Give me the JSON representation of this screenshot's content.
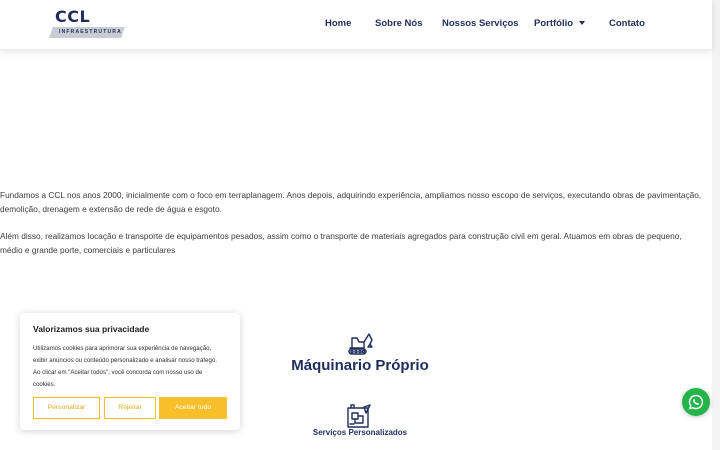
{
  "header": {
    "logo": {
      "name": "CCL",
      "subtitle": "INFRAESTRUTURA"
    },
    "nav": [
      {
        "label": "Home"
      },
      {
        "label": "Sobre Nós"
      },
      {
        "label": "Nossos Serviços"
      },
      {
        "label": "Portfólio",
        "has_dropdown": true
      },
      {
        "label": "Contato"
      }
    ]
  },
  "content": {
    "paragraph1": "Fundamos a CCL nos anos 2000, inicialmente com o foco em terraplanagem. Anos depois, adquirindo experiência, ampliamos nosso escopo de serviços, executando obras de pavimentação, demolição, drenagem e extensão de rede de água e esgoto.",
    "paragraph2": "Além disso, realizamos locação e transporte de equipamentos pesados, assim como o transporte de materiais agregados para construção civil em geral. Atuamos em obras de pequeno, médio e grande porte, comerciais e particulares"
  },
  "features": [
    {
      "icon": "excavator-icon",
      "title": "Máquinario Próprio"
    },
    {
      "icon": "blueprint-icon",
      "title": "Serviços Personalizados"
    }
  ],
  "cookie_banner": {
    "title": "Valorizamos sua privacidade",
    "text": "Utilizamos cookies para aprimorar sua experiência de navegação, exibir anúncios ou conteúdo personalizado e analisar nosso tráfego. Ao clicar em \"Aceitar todos\", você concorda com nosso uso de cookies.",
    "customize_label": "Personalizar",
    "reject_label": "Rejeitar",
    "accept_label": "Aceitar tudo"
  },
  "floating": {
    "icon": "whatsapp-icon"
  },
  "colors": {
    "brand_navy": "#1f2d5c",
    "accent_yellow": "#f7bf2a",
    "whatsapp_green": "#25b449"
  }
}
